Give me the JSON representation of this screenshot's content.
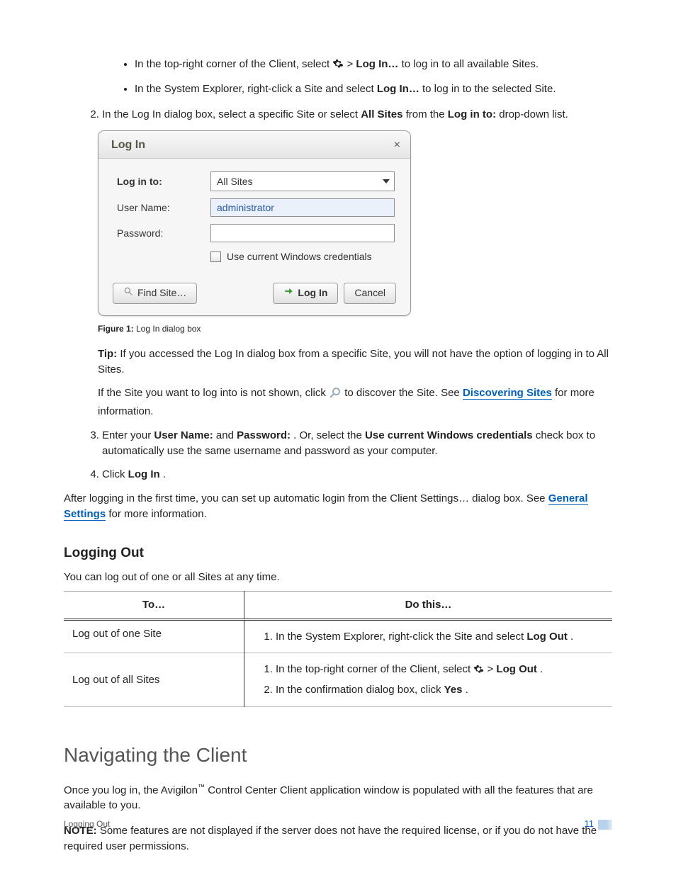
{
  "bullets": {
    "b1_pre": "In the top-right corner of the Client, select ",
    "b1_mid": " > ",
    "b1_bold": "Log In…",
    "b1_post": "  to log in to all available Sites.",
    "b2_pre": "In the System Explorer, right-click a Site and select ",
    "b2_bold": "Log In…",
    "b2_post": " to log in to the selected Site."
  },
  "step2": {
    "pre": "In the Log In dialog box, select a specific Site or select ",
    "b1": "All Sites",
    "mid": " from the ",
    "b2": "Log in to:",
    "post": " drop-down list."
  },
  "dialog": {
    "title": "Log In",
    "close": "×",
    "login_to_label": "Log in to:",
    "login_to_value": "All Sites",
    "user_label": "User Name:",
    "user_value": "administrator",
    "pass_label": "Password:",
    "chk_label": "Use current Windows credentials",
    "find_btn": "Find Site…",
    "login_btn": "Log In",
    "cancel_btn": "Cancel"
  },
  "figure": {
    "label": "Figure 1:",
    "text": " Log In dialog box"
  },
  "tip": {
    "label": "Tip:",
    "text": " If you accessed the Log In dialog box from a specific Site, you will not have the option of logging in to All Sites."
  },
  "discover": {
    "pre": "If the Site you want to log into is not shown, click ",
    "mid": " to discover the Site. See ",
    "link": "Discovering Sites",
    "post": " for more information."
  },
  "step3": {
    "pre": "Enter your ",
    "b1": "User Name:",
    "and": " and ",
    "b2": "Password:",
    "mid": ". Or, select the ",
    "b3": "Use current Windows credentials",
    "post": " check box to automatically use the same username and password as your computer."
  },
  "step4": {
    "pre": "Click ",
    "b1": "Log In",
    "post": "."
  },
  "after": {
    "pre": "After logging in the first time, you can set up automatic login from the Client Settings… dialog box. See ",
    "link": "General Settings",
    "post": " for more information."
  },
  "logout_heading": "Logging Out",
  "logout_intro": "You can log out of one or all Sites at any time.",
  "table": {
    "h1": "To…",
    "h2": "Do this…",
    "r1c1": "Log out of one Site",
    "r1_pre": "In the System Explorer, right-click the Site and select ",
    "r1_b": "Log Out",
    "r1_post": ".",
    "r2c1": "Log out of all Sites",
    "r2a_pre": "In the top-right corner of the Client, select ",
    "r2a_mid": " > ",
    "r2a_b": "Log Out",
    "r2a_post": ".",
    "r2b_pre": "In the confirmation dialog box, click ",
    "r2b_b": "Yes",
    "r2b_post": "."
  },
  "nav_heading": "Navigating the Client",
  "nav_p1_pre": "Once you log in, the Avigilon",
  "nav_p1_tm": "™",
  "nav_p1_post": " Control Center Client application window is populated with all the features that are available to you.",
  "note": {
    "label": "NOTE:",
    "text": " Some features are not displayed if the server does not have the required license, or if you do not have the required user permissions."
  },
  "footer": {
    "section": "Logging Out",
    "page": "11"
  }
}
